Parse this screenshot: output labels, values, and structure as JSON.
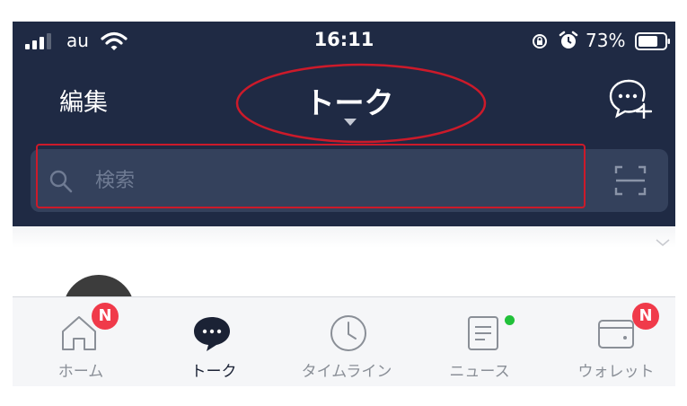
{
  "status_bar": {
    "carrier": "au",
    "time": "16:11",
    "battery": "73%"
  },
  "header": {
    "edit_label": "編集",
    "title": "トーク"
  },
  "search": {
    "placeholder": "検索"
  },
  "tabs": [
    {
      "label": "ホーム",
      "icon": "home-icon",
      "badge": "N"
    },
    {
      "label": "トーク",
      "icon": "chat-icon",
      "active": true
    },
    {
      "label": "タイムライン",
      "icon": "clock-icon"
    },
    {
      "label": "ニュース",
      "icon": "news-icon",
      "dot": true
    },
    {
      "label": "ウォレット",
      "icon": "wallet-icon",
      "badge": "N"
    }
  ],
  "colors": {
    "header_bg": "#1f2a44",
    "annotation_red": "#cc1a2a",
    "badge_red": "#f03a4a",
    "dot_green": "#21c13a"
  }
}
